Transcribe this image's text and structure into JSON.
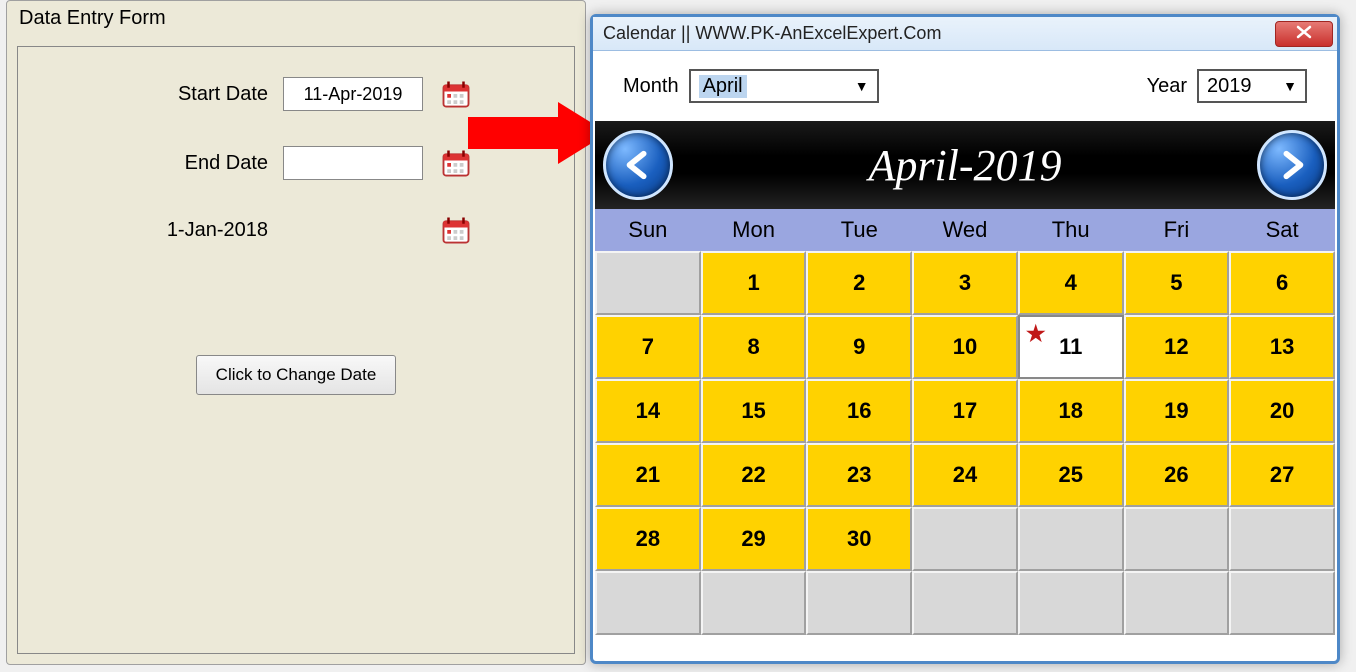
{
  "form": {
    "title": "Data Entry Form",
    "start_label": "Start Date",
    "end_label": "End Date",
    "start_value": "11-Apr-2019",
    "end_value": "",
    "static_date": "1-Jan-2018",
    "change_btn": "Click to Change Date"
  },
  "calendar": {
    "title": "Calendar || WWW.PK-AnExcelExpert.Com",
    "month_label": "Month",
    "year_label": "Year",
    "month_value": "April",
    "year_value": "2019",
    "header_title": "April-2019",
    "day_headers": [
      "Sun",
      "Mon",
      "Tue",
      "Wed",
      "Thu",
      "Fri",
      "Sat"
    ],
    "today": 11,
    "cells": [
      "",
      "1",
      "2",
      "3",
      "4",
      "5",
      "6",
      "7",
      "8",
      "9",
      "10",
      "11",
      "12",
      "13",
      "14",
      "15",
      "16",
      "17",
      "18",
      "19",
      "20",
      "21",
      "22",
      "23",
      "24",
      "25",
      "26",
      "27",
      "28",
      "29",
      "30",
      "",
      "",
      "",
      "",
      "",
      "",
      "",
      "",
      "",
      "",
      ""
    ]
  }
}
